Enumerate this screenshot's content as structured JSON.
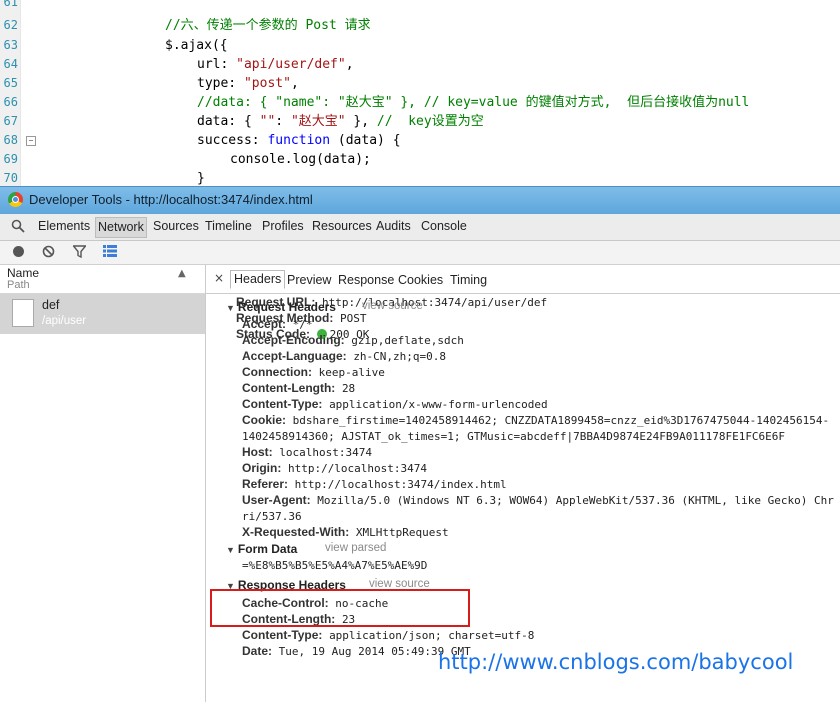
{
  "editor": {
    "lines": [
      {
        "num": "61",
        "parts": []
      },
      {
        "num": "62",
        "parts": [
          {
            "t": "//六、传递一个参数的 Post 请求",
            "c": "cm"
          }
        ]
      },
      {
        "num": "63",
        "parts": [
          {
            "t": "$.ajax({",
            "c": "pl"
          }
        ]
      },
      {
        "num": "64",
        "parts": [
          {
            "t": "url: ",
            "c": "pl"
          },
          {
            "t": "\"api/user/def\"",
            "c": "str"
          },
          {
            "t": ",",
            "c": "pl"
          }
        ]
      },
      {
        "num": "65",
        "parts": [
          {
            "t": "type: ",
            "c": "pl"
          },
          {
            "t": "\"post\"",
            "c": "str"
          },
          {
            "t": ",",
            "c": "pl"
          }
        ]
      },
      {
        "num": "66",
        "parts": [
          {
            "t": "//data: { \"name\": \"赵大宝\" }, // key=value 的键值对方式,  但后台接收值为null",
            "c": "cm"
          }
        ]
      },
      {
        "num": "67",
        "parts": [
          {
            "t": "data: { ",
            "c": "pl"
          },
          {
            "t": "\"\"",
            "c": "str"
          },
          {
            "t": ": ",
            "c": "pl"
          },
          {
            "t": "\"赵大宝\"",
            "c": "str"
          },
          {
            "t": " }, ",
            "c": "pl"
          },
          {
            "t": "//  key设置为空",
            "c": "cm"
          }
        ]
      },
      {
        "num": "68",
        "parts": [
          {
            "t": "success: ",
            "c": "pl"
          },
          {
            "t": "function",
            "c": "kw"
          },
          {
            "t": " (data) {",
            "c": "pl"
          }
        ]
      },
      {
        "num": "69",
        "parts": [
          {
            "t": "console.log(data);",
            "c": "pl"
          }
        ]
      },
      {
        "num": "70",
        "parts": [
          {
            "t": "}",
            "c": "pl"
          }
        ]
      }
    ],
    "fold_symbol": "−"
  },
  "window": {
    "title": "Developer Tools - http://localhost:3474/index.html"
  },
  "tabs": [
    "Elements",
    "Network",
    "Sources",
    "Timeline",
    "Profiles",
    "Resources",
    "Audits",
    "Console"
  ],
  "active_tab": "Network",
  "toolbar_icons": [
    "record-icon",
    "clear-icon",
    "filter-icon",
    "view-toggle-icon"
  ],
  "request_list": {
    "header_name": "Name",
    "header_path": "Path",
    "sort_arrow": "▲",
    "items": [
      {
        "name": "def",
        "path": "/api/user"
      }
    ]
  },
  "detail": {
    "close": "×",
    "tabs": [
      "Headers",
      "Preview",
      "Response",
      "Cookies",
      "Timing"
    ],
    "active_tab": "Headers",
    "general": [
      {
        "key": "Request URL:",
        "value": "http://localhost:3474/api/user/def"
      },
      {
        "key": "Request Method:",
        "value": "POST"
      },
      {
        "key": "Status Code:",
        "value": "200 OK"
      }
    ],
    "status_dot_color": "#3cb33c",
    "request_headers": {
      "title": "Request Headers",
      "link": "view source",
      "rows": [
        {
          "key": "Accept:",
          "value": "*/*"
        },
        {
          "key": "Accept-Encoding:",
          "value": "gzip,deflate,sdch"
        },
        {
          "key": "Accept-Language:",
          "value": "zh-CN,zh;q=0.8"
        },
        {
          "key": "Connection:",
          "value": "keep-alive"
        },
        {
          "key": "Content-Length:",
          "value": "28"
        },
        {
          "key": "Content-Type:",
          "value": "application/x-www-form-urlencoded"
        },
        {
          "key": "Cookie:",
          "value": "bdshare_firstime=1402458914462; CNZZDATA1899458=cnzz_eid%3D1767475044-1402456154-"
        },
        {
          "key": "",
          "value": "1402458914360; AJSTAT_ok_times=1; GTMusic=abcdeff|7BBA4D9874E24FB9A011178FE1FC6E6F"
        },
        {
          "key": "Host:",
          "value": "localhost:3474"
        },
        {
          "key": "Origin:",
          "value": "http://localhost:3474"
        },
        {
          "key": "Referer:",
          "value": "http://localhost:3474/index.html"
        },
        {
          "key": "User-Agent:",
          "value": "Mozilla/5.0 (Windows NT 6.3; WOW64) AppleWebKit/537.36 (KHTML, like Gecko) Chr"
        },
        {
          "key": "",
          "value": "ri/537.36"
        },
        {
          "key": "X-Requested-With:",
          "value": "XMLHttpRequest"
        }
      ]
    },
    "form_data": {
      "title": "Form Data",
      "link": "view parsed",
      "value": "=%E8%B5%B5%E5%A4%A7%E5%AE%9D"
    },
    "response_headers": {
      "title": "Response Headers",
      "link": "view source",
      "rows": [
        {
          "key": "Cache-Control:",
          "value": "no-cache"
        },
        {
          "key": "Content-Length:",
          "value": "23"
        },
        {
          "key": "Content-Type:",
          "value": "application/json; charset=utf-8"
        },
        {
          "key": "Date:",
          "value": "Tue, 19 Aug 2014 05:49:39 GMT"
        }
      ]
    }
  },
  "watermark": "http://www.cnblogs.com/babycool",
  "colors": {
    "highlight_box": "#d81c1c",
    "watermark": "#1a73e8"
  }
}
